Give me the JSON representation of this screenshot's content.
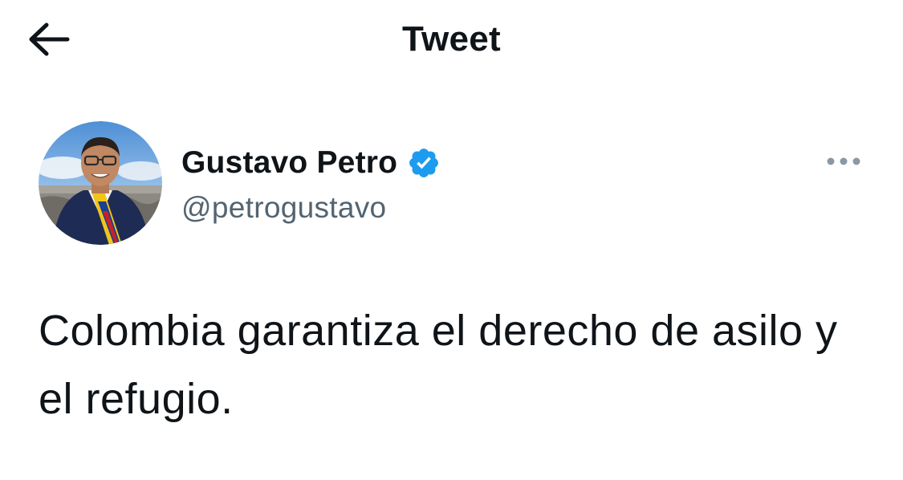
{
  "header": {
    "title": "Tweet",
    "back_icon": "arrow-left-icon"
  },
  "author": {
    "display_name": "Gustavo Petro",
    "handle": "@petrogustavo",
    "verified": true,
    "verified_color": "#1d9bf0",
    "avatar_icon": "profile-photo"
  },
  "actions": {
    "more_icon": "more-horizontal-icon"
  },
  "tweet": {
    "text": "Colombia garantiza el derecho de asilo y el refugio."
  }
}
